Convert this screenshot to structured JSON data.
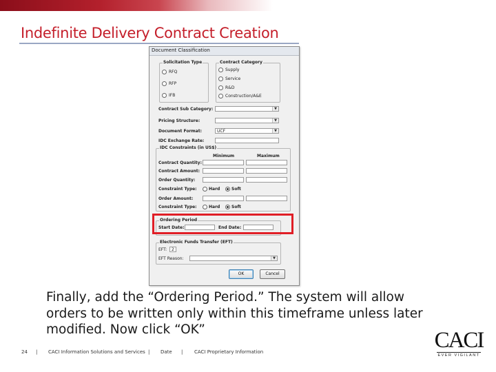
{
  "slide": {
    "title": "Indefinite Delivery Contract Creation",
    "caption": "Finally, add the “Ordering Period.” The system will allow orders to be written only within this timeframe unless later modified. Now click “OK”"
  },
  "dialog": {
    "title": "Document Classification",
    "solicitation_type": {
      "legend": "Solicitation Type",
      "options": [
        "RFQ",
        "RFP",
        "IFB"
      ]
    },
    "contract_category": {
      "legend": "Contract Category",
      "options": [
        "Supply",
        "Service",
        "R&D",
        "Construction/A&E"
      ]
    },
    "contract_sub_category": {
      "label": "Contract Sub Category:",
      "value": ""
    },
    "pricing_structure": {
      "label": "Pricing Structure:",
      "value": ""
    },
    "document_format": {
      "label": "Document Format:",
      "value": "UCF"
    },
    "idc_exchange_rate": {
      "label": "IDC Exchange Rate:",
      "value": ""
    },
    "idc_constraints": {
      "legend": "IDC Constraints (in US$)",
      "col_min": "Minimum",
      "col_max": "Maximum",
      "contract_quantity": "Contract Quantity:",
      "contract_amount": "Contract Amount:",
      "order_quantity": "Order Quantity:",
      "constraint_type_1": "Constraint Type:",
      "hard": "Hard",
      "soft": "Soft",
      "order_amount": "Order Amount:",
      "constraint_type_2": "Constraint Type:"
    },
    "ordering_period": {
      "legend": "Ordering Period",
      "start_label": "Start Date:",
      "start_value": "",
      "end_label": "End Date:",
      "end_value": ""
    },
    "eft": {
      "legend": "Electronic Funds Transfer (EFT)",
      "eft_label": "EFT:",
      "eft_value": "2",
      "reason_label": "EFT Reason:",
      "reason_value": ""
    },
    "buttons": {
      "ok": "OK",
      "cancel": "Cancel"
    }
  },
  "footer": {
    "page": "24",
    "sep": "|",
    "company": "CACI Information Solutions and Services",
    "date": "Date",
    "proprietary": "CACI Proprietary Information"
  },
  "logo": {
    "name": "CACI",
    "tagline": "EVER VIGILANT"
  },
  "colors": {
    "title_red": "#c41e2a",
    "highlight_red": "#e01e26"
  }
}
